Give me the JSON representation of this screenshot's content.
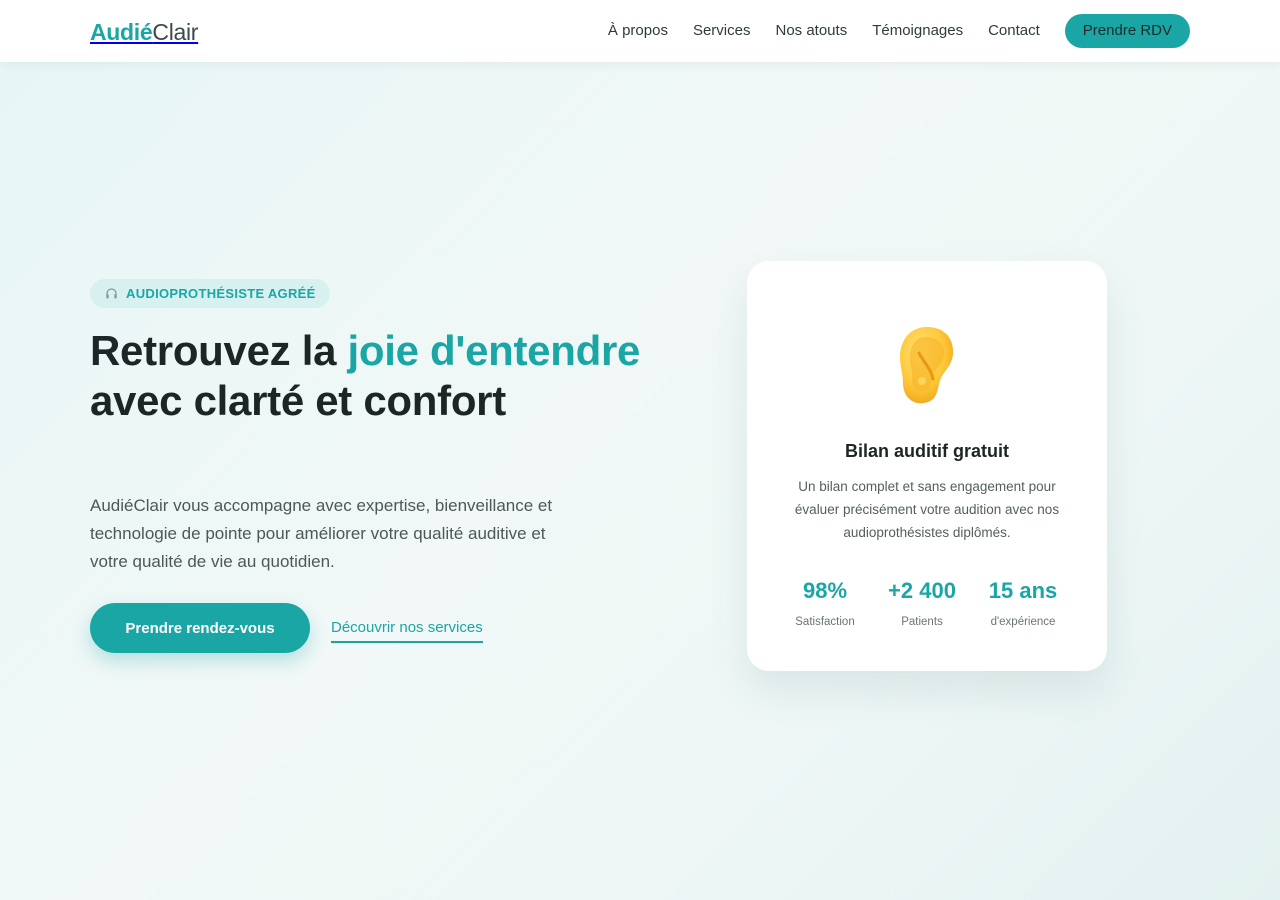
{
  "brand": {
    "part1": "Audié",
    "part2": "Clair"
  },
  "nav": {
    "links": [
      "À propos",
      "Services",
      "Nos atouts",
      "Témoignages",
      "Contact"
    ],
    "cta": "Prendre RDV"
  },
  "hero": {
    "badge_icon": "headphones-icon",
    "badge": "AUDIOPROTHÉSISTE AGRÉÉ",
    "title_line1_plain": "Retrouvez la ",
    "title_accent": "joie d'entendre",
    "title_tail": " avec clarté et confort",
    "lead": "AudiéClair vous accompagne avec expertise, bienveillance et technologie de pointe pour améliorer votre qualité auditive et votre qualité de vie au quotidien.",
    "primary_button": "Prendre rendez-vous",
    "secondary_link": "Découvrir nos services"
  },
  "card": {
    "icon": "ear-icon",
    "title": "Bilan auditif gratuit",
    "description": "Un bilan complet et sans engagement pour évaluer précisément votre audition avec nos audioprothésistes diplômés.",
    "stats": [
      {
        "value": "98%",
        "label": "Satisfaction"
      },
      {
        "value": "+2 400",
        "label": "Patients"
      },
      {
        "value": "15 ans",
        "label": "d'expérience"
      }
    ]
  },
  "colors": {
    "accent": "#1aa6a5",
    "text": "#1c2626",
    "badge_bg": "#d6f1f0"
  }
}
